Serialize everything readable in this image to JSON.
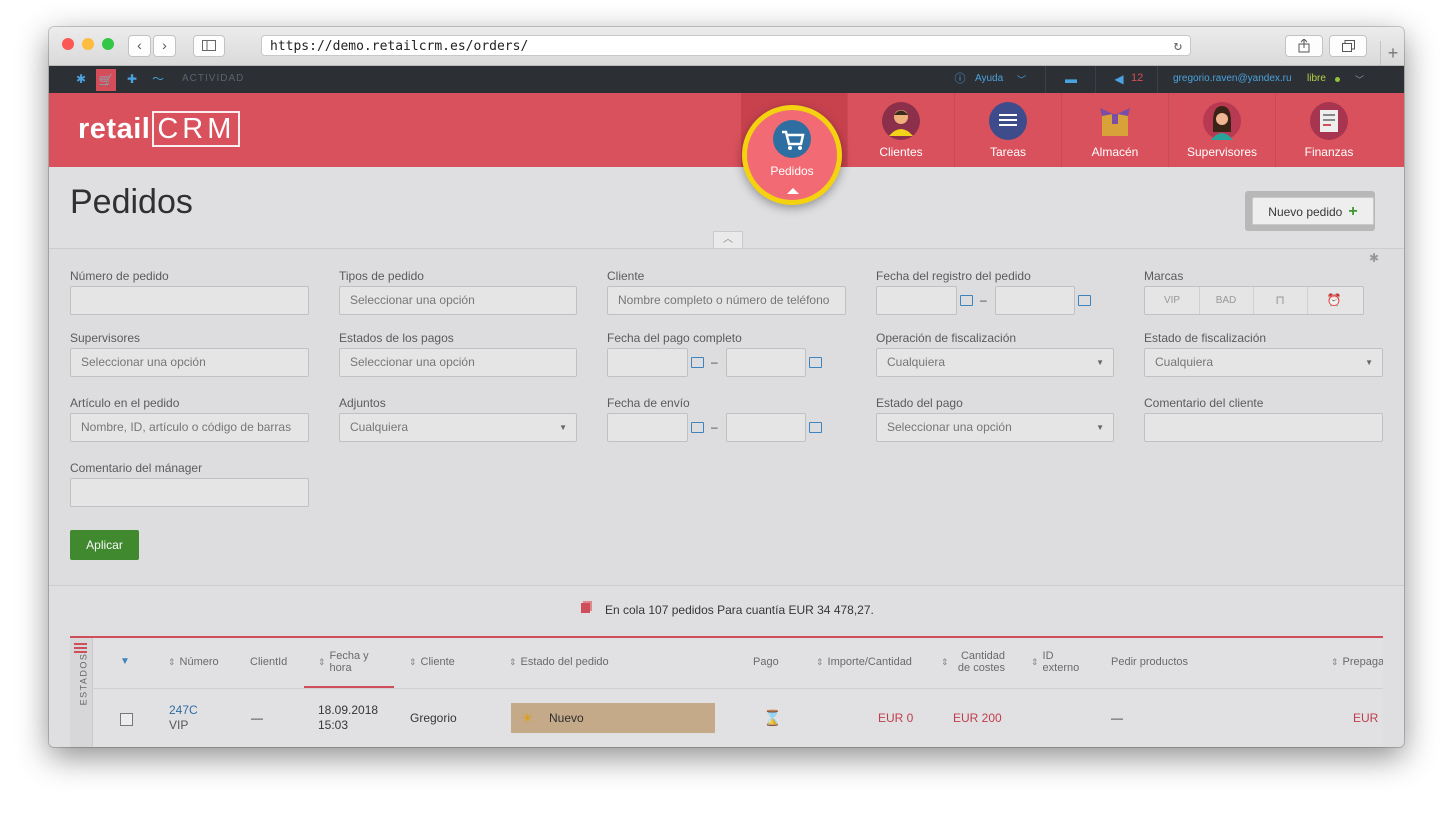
{
  "browser": {
    "url": "https://demo.retailcrm.es/orders/",
    "nav_back": "‹",
    "nav_forward": "›",
    "new_tab": "+"
  },
  "topbar": {
    "activity_label": "ACTIVIDAD",
    "help_label": "Ayuda",
    "notifications_count": "12",
    "user_email": "gregorio.raven@yandex.ru",
    "user_status": "libre"
  },
  "header": {
    "logo_text": "retail",
    "logo_crm": "CRM",
    "nav": [
      {
        "label": "Pedidos",
        "icon": "cart-icon"
      },
      {
        "label": "Clientes",
        "icon": "customer-icon"
      },
      {
        "label": "Tareas",
        "icon": "tasks-icon"
      },
      {
        "label": "Almacén",
        "icon": "warehouse-icon"
      },
      {
        "label": "Supervisores",
        "icon": "supervisors-icon"
      },
      {
        "label": "Finanzas",
        "icon": "finance-icon"
      }
    ]
  },
  "page": {
    "title": "Pedidos",
    "new_order_label": "Nuevo pedido"
  },
  "filters": {
    "order_number": {
      "label": "Número de pedido",
      "value": ""
    },
    "order_types": {
      "label": "Tipos de pedido",
      "placeholder": "Seleccionar una opción"
    },
    "customer": {
      "label": "Cliente",
      "placeholder": "Nombre completo o número de teléfono"
    },
    "registration_date": {
      "label": "Fecha del registro del pedido"
    },
    "brands": {
      "label": "Marcas",
      "options": [
        "VIP",
        "BAD"
      ]
    },
    "supervisors": {
      "label": "Supervisores",
      "placeholder": "Seleccionar una opción"
    },
    "payment_statuses": {
      "label": "Estados de los pagos",
      "placeholder": "Seleccionar una opción"
    },
    "full_payment_date": {
      "label": "Fecha del pago completo"
    },
    "fiscal_operation": {
      "label": "Operación de fiscalización",
      "value": "Cualquiera"
    },
    "fiscal_status": {
      "label": "Estado de fiscalización",
      "value": "Cualquiera"
    },
    "item_in_order": {
      "label": "Artículo en el pedido",
      "placeholder": "Nombre, ID, artículo o código de barras"
    },
    "attachments": {
      "label": "Adjuntos",
      "value": "Cualquiera"
    },
    "shipment_date": {
      "label": "Fecha de envío"
    },
    "payment_status": {
      "label": "Estado del pago",
      "placeholder": "Seleccionar una opción"
    },
    "customer_comment": {
      "label": "Comentario del cliente",
      "value": ""
    },
    "manager_comment": {
      "label": "Comentario del mánager",
      "value": ""
    },
    "dash": "–",
    "apply_label": "Aplicar"
  },
  "queue": {
    "text": "En cola 107 pedidos Para cuantía EUR 34 478,27."
  },
  "table": {
    "side_label": "ESTADOS",
    "columns": {
      "number": "Número",
      "client_id": "ClientId",
      "date": "Fecha y hora",
      "customer": "Cliente",
      "status": "Estado del pedido",
      "payment": "Pago",
      "amount": "Importe/Cantidad",
      "cost": "Cantidad de costes",
      "external_id": "ID externo",
      "order_products": "Pedir productos",
      "prepaid": "Prepaga"
    },
    "rows": [
      {
        "number": "247C",
        "tag": "VIP",
        "client_id": "—",
        "date": "18.09.2018",
        "time": "15:03",
        "customer": "Gregorio",
        "status": "Nuevo",
        "amount": "EUR 0",
        "cost": "EUR 200",
        "order_products": "—",
        "prepaid": "EUR"
      }
    ]
  },
  "colors": {
    "brand_red": "#d9515c",
    "highlight_ring": "#f5d20b",
    "apply_green": "#3d8b2a",
    "status_new": "#c9ae88"
  }
}
